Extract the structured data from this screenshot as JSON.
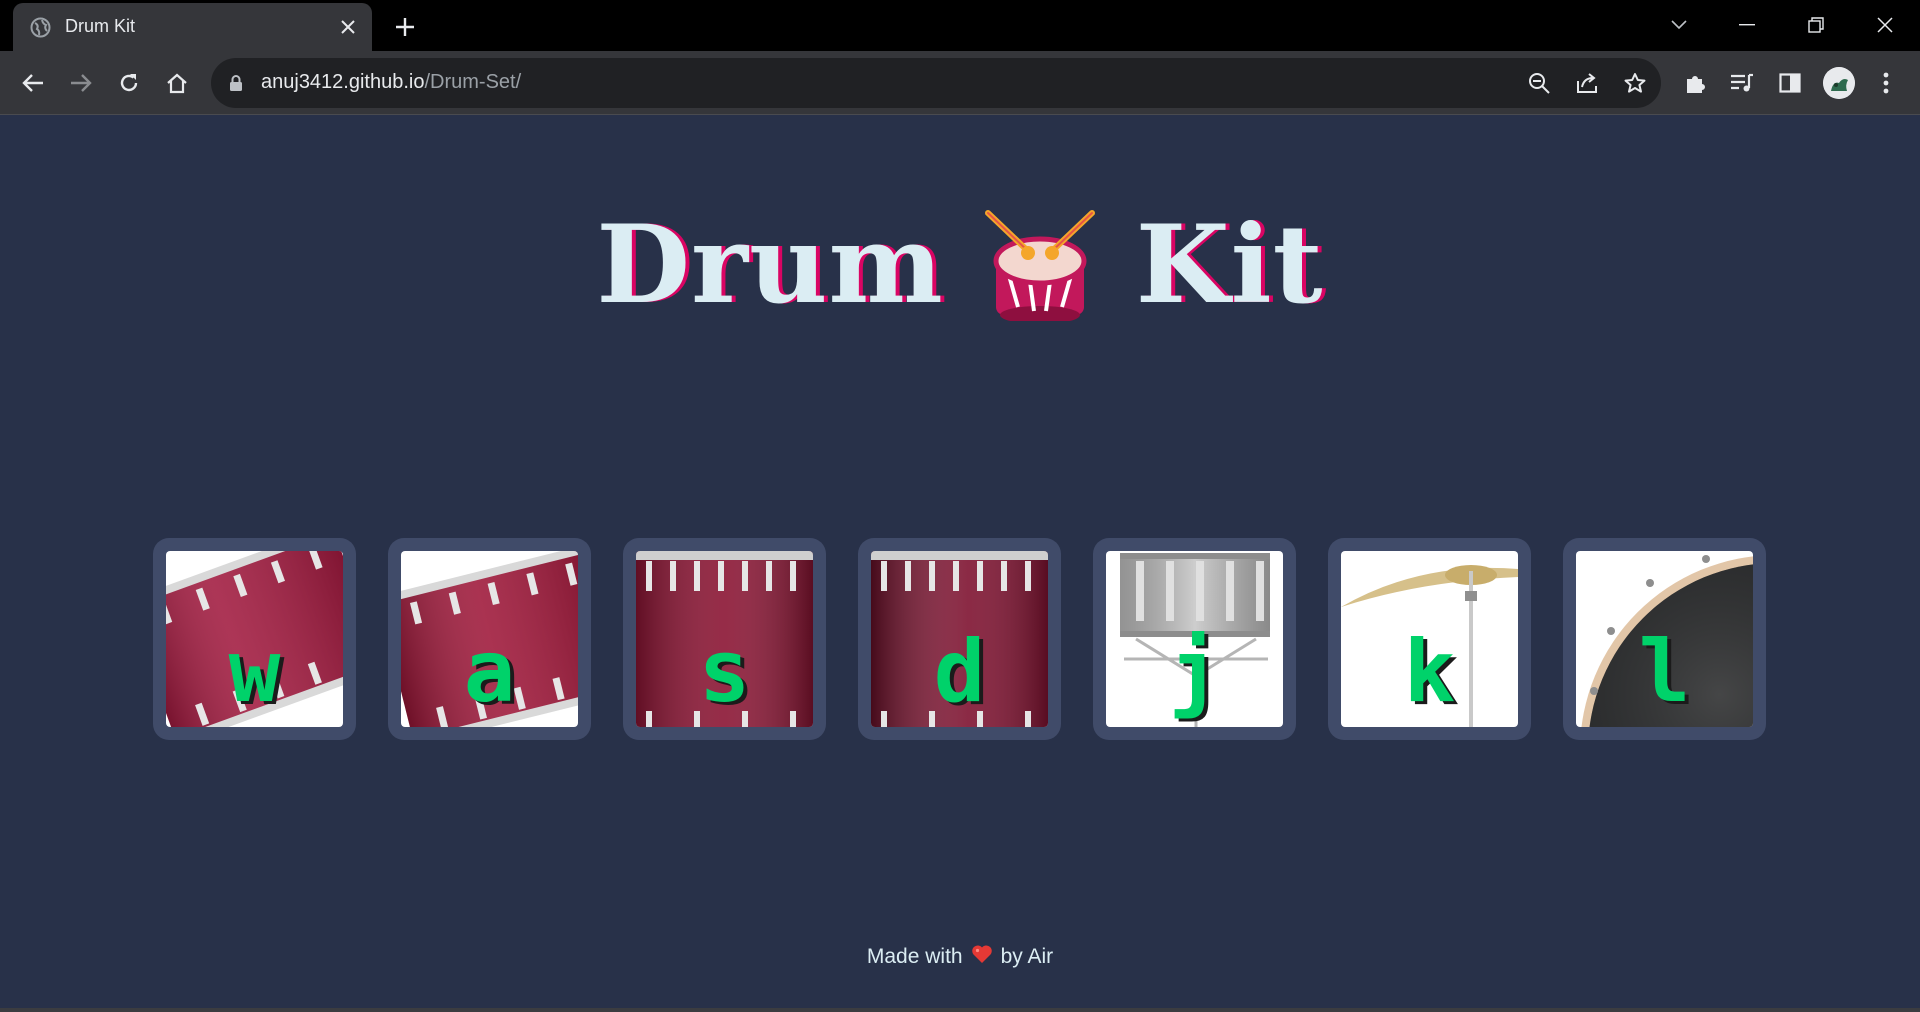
{
  "browser": {
    "tab_title": "Drum Kit",
    "url_host": "anuj3412.github.io",
    "url_path": "/Drum-Set/"
  },
  "page": {
    "title_left": "Drum",
    "title_right": "Kit",
    "title_emoji": "drum-icon",
    "keys": [
      "w",
      "a",
      "s",
      "d",
      "j",
      "k",
      "l"
    ],
    "pad_images": [
      "crash-drum",
      "kick-drum",
      "snare-drum",
      "tom-drum",
      "snare-side",
      "cymbal",
      "bass-drum"
    ],
    "footer_before": "Made with",
    "footer_heart": "heart-icon",
    "footer_after": "by Air"
  },
  "colors": {
    "background": "#283149",
    "pad_frame": "#404b69",
    "key_letter": "#00d26a",
    "title": "#dbedf3",
    "title_shadow": "#da0463"
  }
}
